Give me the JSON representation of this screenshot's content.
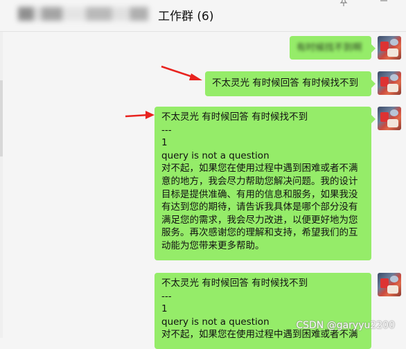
{
  "header": {
    "title_prefix_blurred": "[blurred]",
    "title": "工作群 (6)"
  },
  "messages": [
    {
      "text": "有时候找不到啊",
      "blurred": true
    },
    {
      "text": "不太灵光 有时候回答 有时候找不到"
    },
    {
      "lines": [
        "不太灵光 有时候回答 有时候找不到",
        "---",
        "1",
        "query is not a question",
        "对不起，如果您在使用过程中遇到困难或者不满意的地方，我会尽力帮助您解决问题。我的设计目标是提供准确、有用的信息和服务，如果我没有达到您的期待，请告诉我具体是哪个部分没有满足您的需求，我会尽力改进，以便更好地为您服务。再次感谢您的理解和支持，希望我们的互动能为您带来更多帮助。"
      ]
    },
    {
      "lines": [
        "不太灵光 有时候回答 有时候找不到",
        "---",
        "1",
        "query is not a question",
        "对不起，如果您在使用过程中遇到困难或者不满"
      ]
    }
  ],
  "watermark": "CSDN @garyyu2200",
  "colors": {
    "bubble": "#95ec69",
    "arrow": "#e8231f",
    "background": "#f5f5f5"
  },
  "icons": [
    "pin-icon",
    "minimize-icon",
    "avatar-image",
    "red-arrow-annotation"
  ]
}
